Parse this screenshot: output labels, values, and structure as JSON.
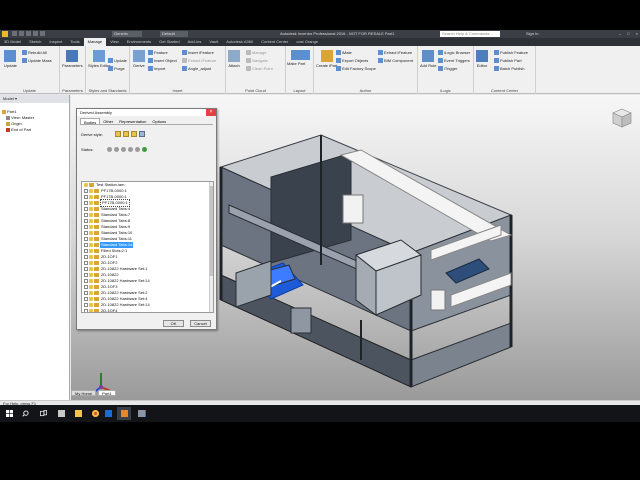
{
  "titlebar": {
    "workspace": "Generic",
    "appearance": "Default",
    "title": "Autodesk Inventor Professional 2016 - NOT FOR RESALE   Part1",
    "search_placeholder": "Search Help & Commands...",
    "user": "Sign In",
    "window_controls": [
      "–",
      "□",
      "×"
    ]
  },
  "ribbon_tabs": [
    "3D Model",
    "Sketch",
    "Inspect",
    "Tools",
    "Manage",
    "View",
    "Environments",
    "Get Started",
    "Add-Ins",
    "Vault",
    "Autodesk A360",
    "Content Center",
    "cost Orange"
  ],
  "active_tab": "Manage",
  "ribbon": {
    "groups": [
      {
        "label": "Update",
        "buttons": [
          "Update",
          "Rebuild All",
          "Update Mass"
        ]
      },
      {
        "label": "Parameters",
        "buttons": [
          "Parameters"
        ]
      },
      {
        "label": "Styles and Standards",
        "buttons": [
          "Styles Editor",
          "Update",
          "Purge"
        ]
      },
      {
        "label": "Insert",
        "buttons": [
          "Derive",
          "Feature",
          "Insert Object",
          "Import",
          "Insert iFeature",
          "Extract iFeature",
          "Angle_adjust"
        ]
      },
      {
        "label": "Point Cloud",
        "buttons": [
          "Attach",
          "Manage",
          "Navigate",
          "Clean Point"
        ]
      },
      {
        "label": "Layout",
        "buttons": [
          "Make Part",
          "Make Components"
        ]
      },
      {
        "label": "Author",
        "buttons": [
          "Create iPart",
          "iMate",
          "Export Objects",
          "Edit Factory Scope",
          "Extract iFeature",
          "BIM Component"
        ]
      },
      {
        "label": "iLogic",
        "buttons": [
          "Add Rule",
          "iLogic Browser",
          "Event Triggers",
          "iTrigger"
        ]
      },
      {
        "label": "Content Center",
        "buttons": [
          "Editor",
          "Publish Feature",
          "Publish Part",
          "Batch Publish"
        ]
      }
    ]
  },
  "browser": {
    "header": "Model ▾",
    "nodes": [
      "Part1",
      "View: Master",
      "Origin",
      "End of Part"
    ]
  },
  "dialog": {
    "title": "Derived Assembly",
    "tabs": [
      "Bodies",
      "Other",
      "Representation",
      "Options"
    ],
    "derive_style_label": "Derive style:",
    "status_label": "Status:",
    "tree_items": [
      {
        "label": "Test Station.iam",
        "state": "root"
      },
      {
        "label": "PF17B-0000:1",
        "state": ""
      },
      {
        "label": "PF17B-0000:1",
        "state": ""
      },
      {
        "label": "PF17B-0000:1",
        "state": "box"
      },
      {
        "label": "Standard Tabs:4",
        "state": ""
      },
      {
        "label": "Standard Tabs:7",
        "state": ""
      },
      {
        "label": "Standard Tabs:8",
        "state": ""
      },
      {
        "label": "Standard Tabs:9",
        "state": ""
      },
      {
        "label": "Standard Tabs:10",
        "state": ""
      },
      {
        "label": "Standard Tabs:11",
        "state": ""
      },
      {
        "label": "Standard Tabs:14",
        "state": "sel"
      },
      {
        "label": "Filled Slots:2:1",
        "state": ""
      },
      {
        "label": "2D-1OF1",
        "state": ""
      },
      {
        "label": "2D-1OF2",
        "state": ""
      },
      {
        "label": "2D-10822 Hardware Set:1",
        "state": ""
      },
      {
        "label": "2D-10822",
        "state": ""
      },
      {
        "label": "2D-10822 Hardware Set:14",
        "state": ""
      },
      {
        "label": "2D-1OF3",
        "state": ""
      },
      {
        "label": "2D-10822 Hardware Set:2",
        "state": ""
      },
      {
        "label": "2D-10822 Hardware Set:4",
        "state": ""
      },
      {
        "label": "2D-10822 Hardware Set:14",
        "state": ""
      },
      {
        "label": "2D-1OF4",
        "state": ""
      },
      {
        "label": "2D-10822 Hardware Set:16",
        "state": ""
      },
      {
        "label": "2D-1OF5",
        "state": ""
      },
      {
        "label": "BO-M5:1",
        "state": ""
      },
      {
        "label": "Monitor Platform:1",
        "state": ""
      }
    ],
    "ok": "OK",
    "cancel": "Cancel"
  },
  "doc_tabs": [
    "My Home",
    "Part1"
  ],
  "status_bar": "For Help, press F1",
  "taskbar": {
    "icons": [
      "windows-icon",
      "search-icon",
      "task-view-icon",
      "calculator-icon",
      "file-explorer-icon",
      "chrome-icon",
      "outlook-icon",
      "onenote-icon",
      "store-icon",
      "inventor-icon",
      "photos-icon"
    ]
  },
  "colors": {
    "selection": "#3399ff",
    "accent_blue": "#1e5bd8",
    "ribbon_bg": "#f0f0f0",
    "title_bg": "#3b3f45",
    "taskbar_bg": "#121418",
    "inventor_orange": "#e5872b"
  }
}
